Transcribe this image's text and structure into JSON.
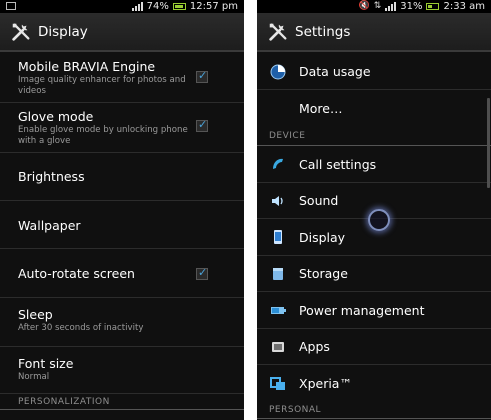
{
  "left": {
    "status": {
      "battery": "74%",
      "time": "12:57 pm"
    },
    "title": "Display",
    "items": [
      {
        "title": "Mobile BRAVIA Engine",
        "subtitle": "Image quality enhancer for photos and videos",
        "checked": true
      },
      {
        "title": "Glove mode",
        "subtitle": "Enable glove mode by unlocking phone with a glove",
        "checked": true
      },
      {
        "title": "Brightness"
      },
      {
        "title": "Wallpaper"
      },
      {
        "title": "Auto-rotate screen",
        "checked": true
      },
      {
        "title": "Sleep",
        "subtitle": "After 30 seconds of inactivity"
      },
      {
        "title": "Font size",
        "subtitle": "Normal"
      }
    ],
    "section_personalization": "PERSONALIZATION"
  },
  "right": {
    "status": {
      "battery": "31%",
      "time": "2:33 am"
    },
    "title": "Settings",
    "items": [
      {
        "label": "Data usage",
        "icon": "data-usage-icon"
      },
      {
        "label": "More…"
      },
      {
        "label": "Call settings",
        "icon": "phone-icon"
      },
      {
        "label": "Sound",
        "icon": "speaker-icon"
      },
      {
        "label": "Display",
        "icon": "display-icon"
      },
      {
        "label": "Storage",
        "icon": "storage-icon"
      },
      {
        "label": "Power management",
        "icon": "battery-icon"
      },
      {
        "label": "Apps",
        "icon": "apps-icon"
      },
      {
        "label": "Xperia™",
        "icon": "xperia-icon"
      }
    ],
    "section_device": "DEVICE",
    "section_personal": "PERSONAL"
  },
  "colors": {
    "accent": "#4ba3d9",
    "background": "#101010",
    "secondary_text": "#9a9a9a"
  }
}
